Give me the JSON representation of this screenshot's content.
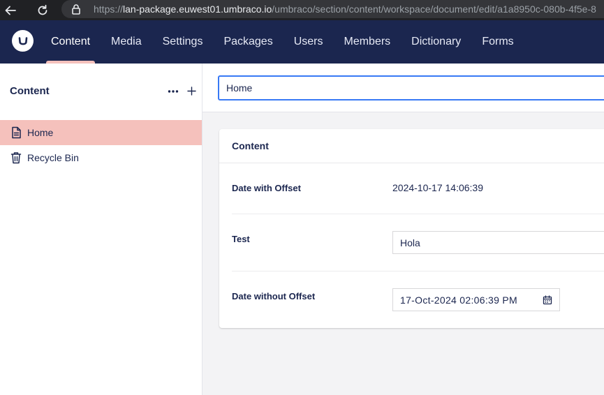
{
  "browser": {
    "url_prefix": "https://",
    "url_host": "lan-package.euwest01.umbraco.io",
    "url_path": "/umbraco/section/content/workspace/document/edit/a1a8950c-080b-4f5e-8"
  },
  "topnav": {
    "logo_icon": "umbraco-logo-icon",
    "items": [
      {
        "label": "Content",
        "active": true
      },
      {
        "label": "Media"
      },
      {
        "label": "Settings"
      },
      {
        "label": "Packages"
      },
      {
        "label": "Users"
      },
      {
        "label": "Members"
      },
      {
        "label": "Dictionary"
      },
      {
        "label": "Forms"
      }
    ]
  },
  "sidebar": {
    "title": "Content",
    "tree": [
      {
        "label": "Home",
        "icon": "document-icon",
        "selected": true
      },
      {
        "label": "Recycle Bin",
        "icon": "trash-icon"
      }
    ]
  },
  "editor": {
    "name_value": "Home",
    "panel_title": "Content",
    "properties": {
      "date_with_offset": {
        "label": "Date with Offset",
        "value": "2024-10-17 14:06:39"
      },
      "test": {
        "label": "Test",
        "value": "Hola"
      },
      "date_without_offset": {
        "label": "Date without Offset",
        "value": "17-Oct-2024 02:06:39 PM"
      }
    }
  },
  "colors": {
    "nav_bg": "#1b264f",
    "active_accent": "#f5c1bc",
    "focus_border": "#3879f5"
  }
}
